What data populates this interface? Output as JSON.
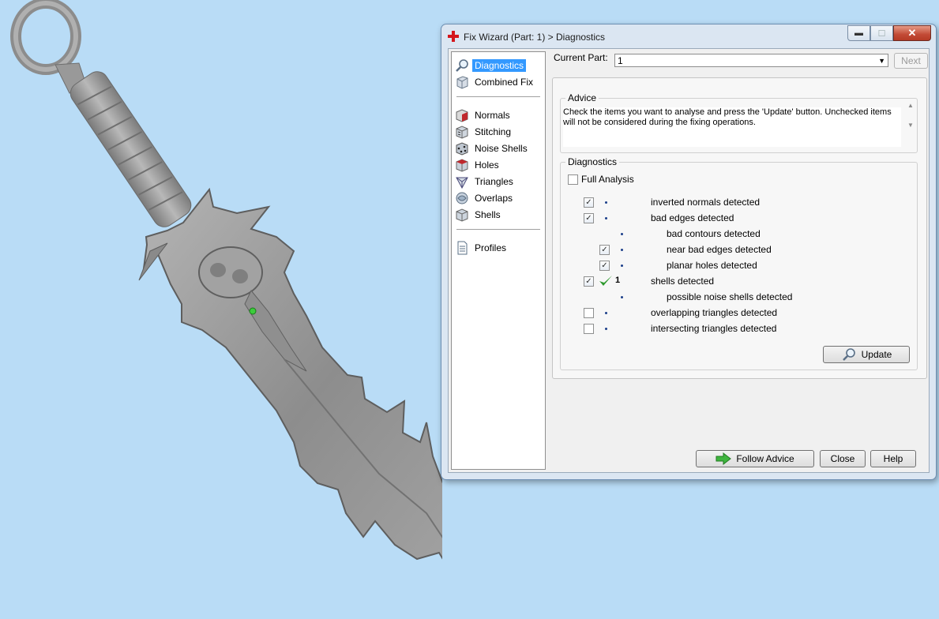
{
  "window": {
    "title": "Fix Wizard (Part: 1) > Diagnostics",
    "min_glyph": "▬",
    "max_glyph": "☐",
    "close_glyph": "✕"
  },
  "sidebar": {
    "items_top": [
      {
        "label": "Diagnostics",
        "icon": "magnifier-icon",
        "selected": true
      },
      {
        "label": "Combined Fix",
        "icon": "cube-icon"
      }
    ],
    "items_mid": [
      {
        "label": "Normals",
        "icon": "normals-cube-icon"
      },
      {
        "label": "Stitching",
        "icon": "stitching-cube-icon"
      },
      {
        "label": "Noise Shells",
        "icon": "noise-shells-icon"
      },
      {
        "label": "Holes",
        "icon": "holes-cube-icon"
      },
      {
        "label": "Triangles",
        "icon": "triangles-icon"
      },
      {
        "label": "Overlaps",
        "icon": "overlaps-icon"
      },
      {
        "label": "Shells",
        "icon": "shells-icon"
      }
    ],
    "items_bottom": [
      {
        "label": "Profiles",
        "icon": "document-icon"
      }
    ]
  },
  "current_part": {
    "label": "Current Part:",
    "value": "1",
    "arrow": "▼",
    "next_label": "Next"
  },
  "advice": {
    "title": "Advice",
    "text": "Check the items you want to analyse and press the 'Update' button. Unchecked items will not be considered during the fixing operations."
  },
  "diagnostics": {
    "title": "Diagnostics",
    "full_analysis_label": "Full Analysis",
    "full_analysis_checked": false,
    "rows": [
      {
        "label": "inverted normals detected",
        "checked": true,
        "indent": 0,
        "has_checkbox": true
      },
      {
        "label": "bad edges detected",
        "checked": true,
        "indent": 0,
        "has_checkbox": true
      },
      {
        "label": "bad contours detected",
        "checked": false,
        "indent": 1,
        "has_checkbox": false
      },
      {
        "label": "near bad edges detected",
        "checked": true,
        "indent": 1,
        "has_checkbox": true
      },
      {
        "label": "planar holes detected",
        "checked": true,
        "indent": 1,
        "has_checkbox": true
      },
      {
        "label": "shells detected",
        "checked": true,
        "indent": 0,
        "has_checkbox": true,
        "status": "ok",
        "count": "1"
      },
      {
        "label": "possible noise shells detected",
        "checked": false,
        "indent": 1,
        "has_checkbox": false
      },
      {
        "label": "overlapping triangles detected",
        "checked": false,
        "indent": 0,
        "has_checkbox": true
      },
      {
        "label": "intersecting triangles detected",
        "checked": false,
        "indent": 0,
        "has_checkbox": true
      }
    ],
    "update_label": "Update"
  },
  "footer": {
    "follow_advice_label": "Follow Advice",
    "close_label": "Close",
    "help_label": "Help"
  },
  "colors": {
    "viewport_bg": "#b9dcf6",
    "model_gray": "#9a9a9a",
    "selection_blue": "#3399ff",
    "ok_green": "#2e9a2e"
  }
}
